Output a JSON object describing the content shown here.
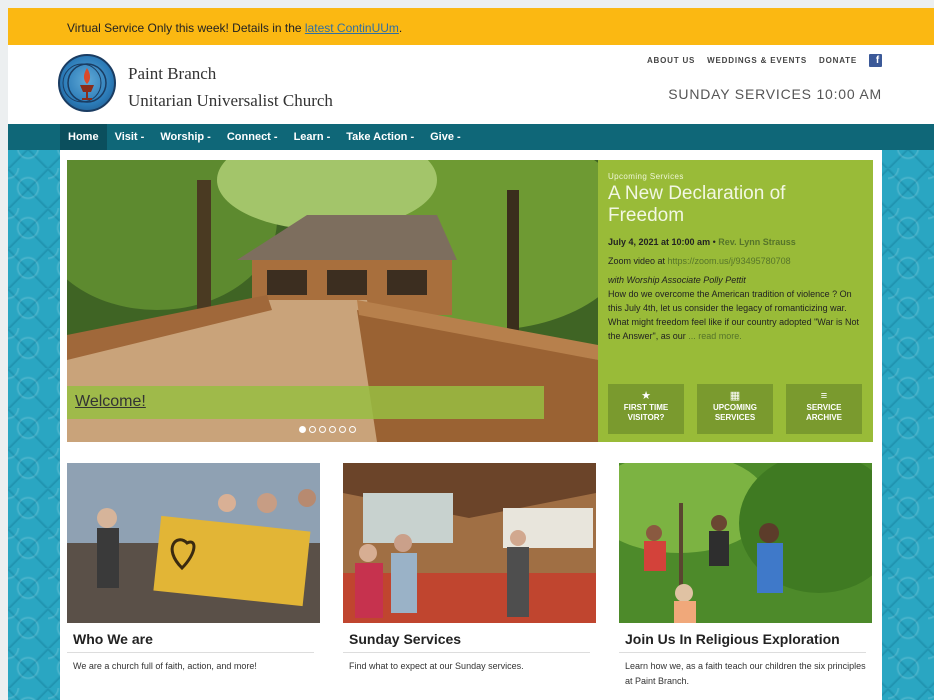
{
  "alert": {
    "text": "Virtual Service Only this week! Details in the ",
    "link": "latest ContinUUm",
    "tail": "."
  },
  "header": {
    "name_line1": "Paint Branch",
    "name_line2": "Unitarian Universalist Church",
    "links": [
      "ABOUT US",
      "WEDDINGS & EVENTS",
      "DONATE"
    ],
    "facebook_icon": "facebook-icon",
    "services": "SUNDAY SERVICES 10:00 AM"
  },
  "nav": {
    "items": [
      "Home",
      "Visit -",
      "Worship -",
      "Connect -",
      "Learn -",
      "Take Action -",
      "Give -"
    ]
  },
  "hero": {
    "caption": "Welcome!",
    "slides_total": 6,
    "active_slide": 1
  },
  "upcoming": {
    "label": "Upcoming Services",
    "title": "A New Declaration of Freedom",
    "date": "July 4, 2021 at 10:00 am",
    "bullet": " • ",
    "minister": "Rev. Lynn Strauss",
    "zoom_prefix": "Zoom video at ",
    "zoom_link": "https://zoom.us/j/93495780708",
    "associate": "with Worship Associate Polly Pettit",
    "blurb": "How do we overcome the American tradition of violence ? On this July 4th, let us consider the legacy of romanticizing war. What might freedom feel like if our country adopted \"War is Not the Answer\", as our ",
    "read_more": "... read more.",
    "buttons": [
      {
        "icon": "star-icon",
        "glyph": "★",
        "label1": "FIRST TIME",
        "label2": "VISITOR?"
      },
      {
        "icon": "calendar-icon",
        "glyph": "▦",
        "label1": "UPCOMING",
        "label2": "SERVICES"
      },
      {
        "icon": "list-icon",
        "glyph": "≡",
        "label1": "SERVICE",
        "label2": "ARCHIVE"
      }
    ]
  },
  "cards": [
    {
      "title": "Who We are",
      "text": "We are a church full of faith, action, and more!"
    },
    {
      "title": "Sunday Services",
      "text": "Find what to expect at our Sunday services."
    },
    {
      "title": "Join Us In Religious Exploration",
      "text": "Learn how we, as a faith teach our children the six principles at Paint Branch."
    }
  ],
  "colors": {
    "alert": "#fbb812",
    "nav": "#0f6778",
    "panel": "#99bb38",
    "background": "#2aa6c2"
  }
}
